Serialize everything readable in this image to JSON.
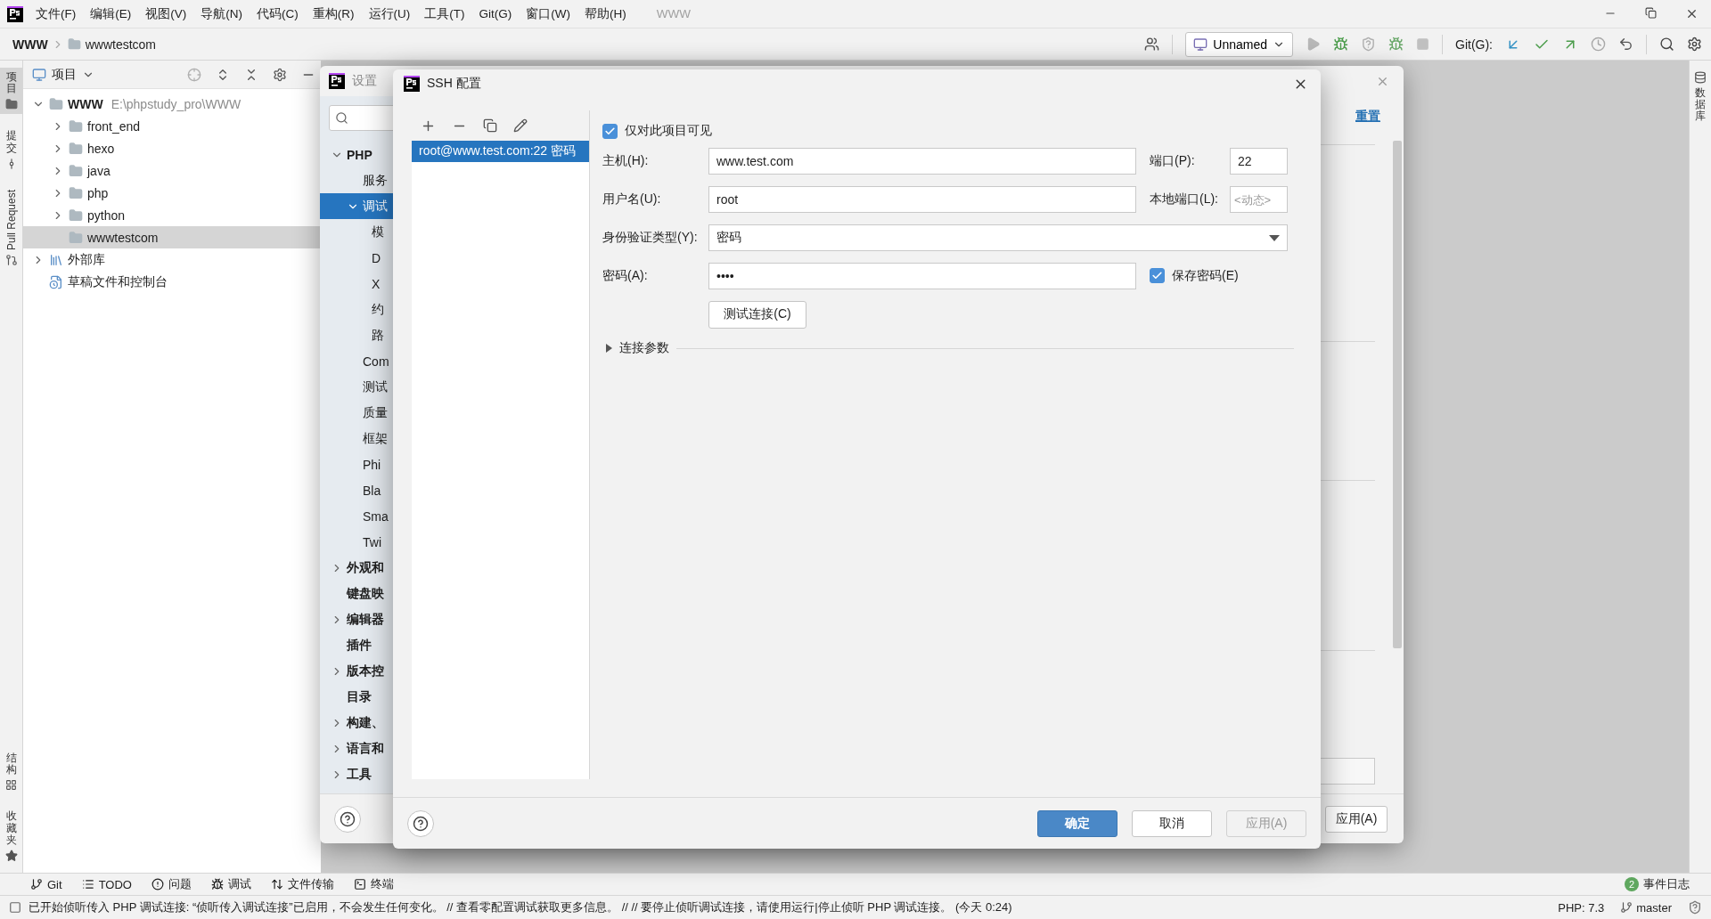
{
  "menu_bar": {
    "items": [
      "文件(F)",
      "编辑(E)",
      "视图(V)",
      "导航(N)",
      "代码(C)",
      "重构(R)",
      "运行(U)",
      "工具(T)",
      "Git(G)",
      "窗口(W)",
      "帮助(H)"
    ],
    "project_title": "WWW"
  },
  "navigation_bar": {
    "breadcrumb": [
      "WWW",
      "wwwtestcom"
    ],
    "run_configuration": "Unnamed",
    "git_label": "Git(G):"
  },
  "left_stripe": {
    "top_tabs": [
      {
        "label": "项目",
        "kind": "cjk",
        "selected": true
      },
      {
        "label": "提交",
        "kind": "cjk",
        "selected": false
      },
      {
        "label": "Pull Request",
        "kind": "latin",
        "selected": false
      }
    ],
    "bottom_tabs": [
      {
        "label": "结构",
        "kind": "cjk",
        "selected": false
      },
      {
        "label": "收藏夹",
        "kind": "cjk",
        "selected": false
      }
    ]
  },
  "right_stripe": {
    "tabs": [
      {
        "label": "数据库",
        "selected": false
      }
    ]
  },
  "project_panel": {
    "title": "项目",
    "tree": [
      {
        "label": "WWW",
        "path": "E:\\phpstudy_pro\\WWW",
        "kind": "folder",
        "expanded": true,
        "selected": false,
        "children": [
          {
            "label": "front_end",
            "kind": "folder",
            "expanded": false,
            "selected": false
          },
          {
            "label": "hexo",
            "kind": "folder",
            "expanded": false,
            "selected": false
          },
          {
            "label": "java",
            "kind": "folder",
            "expanded": false,
            "selected": false
          },
          {
            "label": "php",
            "kind": "folder",
            "expanded": false,
            "selected": false
          },
          {
            "label": "python",
            "kind": "folder",
            "expanded": false,
            "selected": false
          },
          {
            "label": "wwwtestcom",
            "kind": "plain_folder",
            "selected": true
          }
        ]
      },
      {
        "label": "外部库",
        "kind": "library",
        "expanded": false,
        "selected": false
      },
      {
        "label": "草稿文件和控制台",
        "kind": "scratch",
        "selected": false
      }
    ]
  },
  "settings_dialog": {
    "title": "设置",
    "tree": [
      {
        "label": "PHP",
        "expanded": true,
        "selected": false,
        "children": [
          {
            "label": "服务",
            "selected": false
          },
          {
            "label": "调试",
            "expanded": true,
            "selected": true,
            "children": [
              {
                "label": "模",
                "selected": false
              },
              {
                "label": "D",
                "selected": false
              },
              {
                "label": "X",
                "selected": false
              },
              {
                "label": "约",
                "selected": false
              },
              {
                "label": "路",
                "selected": false
              }
            ]
          },
          {
            "label": "Com",
            "selected": false
          },
          {
            "label": "测试",
            "selected": false
          },
          {
            "label": "质量",
            "selected": false
          },
          {
            "label": "框架",
            "selected": false
          },
          {
            "label": "Phi",
            "selected": false
          },
          {
            "label": "Bla",
            "selected": false
          },
          {
            "label": "Sma",
            "selected": false
          },
          {
            "label": "Twi",
            "selected": false
          }
        ]
      },
      {
        "label": "外观和",
        "expanded": false,
        "selected": false
      },
      {
        "label": "键盘映",
        "selected": false
      },
      {
        "label": "编辑器",
        "expanded": false,
        "selected": false
      },
      {
        "label": "插件",
        "selected": false
      },
      {
        "label": "版本控",
        "expanded": false,
        "selected": false
      },
      {
        "label": "目录",
        "selected": false
      },
      {
        "label": "构建、",
        "expanded": false,
        "selected": false
      },
      {
        "label": "语言和",
        "expanded": false,
        "selected": false
      },
      {
        "label": "工具",
        "expanded": false,
        "selected": false
      }
    ],
    "reset_link": "重置",
    "apply_button": "应用(A)"
  },
  "ssh_dialog": {
    "title": "SSH 配置",
    "configurations": [
      {
        "label": "root@www.test.com:22 密码",
        "selected": true
      }
    ],
    "project_only": {
      "label": "仅对此项目可见",
      "checked": true
    },
    "host": {
      "label": "主机(H):",
      "value": "www.test.com"
    },
    "port": {
      "label": "端口(P):",
      "value": "22"
    },
    "username": {
      "label": "用户名(U):",
      "value": "root"
    },
    "local_port": {
      "label": "本地端口(L):",
      "placeholder": "<动态>"
    },
    "auth_type": {
      "label": "身份验证类型(Y):",
      "value": "密码"
    },
    "password": {
      "label": "密码(A):",
      "value": "••••"
    },
    "save_password": {
      "label": "保存密码(E)",
      "checked": true
    },
    "test_button": "测试连接(C)",
    "connection_params": {
      "label": "连接参数",
      "expanded": false
    },
    "buttons": [
      {
        "label": "确定",
        "kind": "primary",
        "disabled": false
      },
      {
        "label": "取消",
        "kind": "normal",
        "disabled": false
      },
      {
        "label": "应用(A)",
        "kind": "normal",
        "disabled": true
      }
    ]
  },
  "tool_window_bar": {
    "items": [
      {
        "label": "Git",
        "kind": "git"
      },
      {
        "label": "TODO",
        "kind": "todo"
      },
      {
        "label": "问题",
        "kind": "problems"
      },
      {
        "label": "调试",
        "kind": "debug"
      },
      {
        "label": "文件传输",
        "kind": "transfer"
      },
      {
        "label": "终端",
        "kind": "terminal"
      }
    ],
    "event_log": {
      "count": "2",
      "label": "事件日志"
    }
  },
  "status_bar": {
    "message": "已开始侦听传入 PHP 调试连接: “侦听传入调试连接”已启用，不会发生任何变化。 // 查看零配置调试获取更多信息。 // // 要停止侦听调试连接，请使用运行|停止侦听 PHP 调试连接。 (今天 0:24)",
    "php_version": "PHP: 7.3",
    "branch": "master"
  }
}
